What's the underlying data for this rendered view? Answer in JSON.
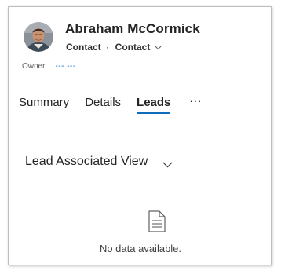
{
  "header": {
    "title": "Abraham McCormick",
    "entity_type": "Contact",
    "separator": "·",
    "form_selector": "Contact",
    "form_selector_icon": "chevron-down-icon"
  },
  "owner": {
    "label": "Owner",
    "value": "--- ---"
  },
  "tabs": [
    {
      "label": "Summary",
      "selected": false
    },
    {
      "label": "Details",
      "selected": false
    },
    {
      "label": "Leads",
      "selected": true
    },
    {
      "label": "···",
      "selected": false
    }
  ],
  "view": {
    "title": "Lead Associated View",
    "chevron_icon": "chevron-down-icon"
  },
  "empty_state": {
    "icon": "document-icon",
    "message": "No data available."
  },
  "colors": {
    "accent": "#0f6cbd",
    "text": "#242424",
    "muted": "#605e5c"
  }
}
